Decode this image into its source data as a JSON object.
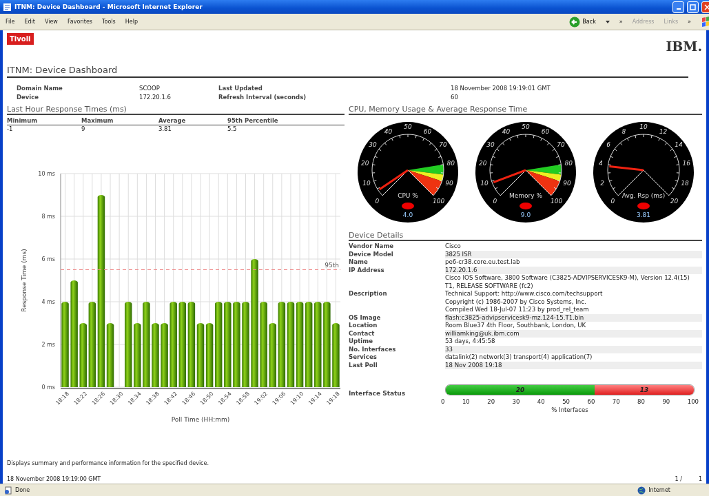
{
  "window": {
    "title": "ITNM: Device Dashboard - Microsoft Internet Explorer"
  },
  "menu": [
    "File",
    "Edit",
    "View",
    "Favorites",
    "Tools",
    "Help"
  ],
  "toolbar": {
    "back": "Back",
    "chevron": "»",
    "address": "Address",
    "links": "Links",
    "links_chevron": "»"
  },
  "header": {
    "badge": "Tivoli",
    "logo": "IBM.",
    "title": "ITNM: Device Dashboard"
  },
  "summary": [
    {
      "label": "Domain Name",
      "value": "SCOOP",
      "label2": "Last Updated",
      "value2": "18 November 2008 19:19:01 GMT"
    },
    {
      "label": "Device",
      "value": "172.20.1.6",
      "label2": "Refresh Interval (seconds)",
      "value2": "60"
    }
  ],
  "response": {
    "title": "Last Hour Response Times (ms)",
    "columns": [
      "Minimum",
      "Maximum",
      "Average",
      "95th Percentile"
    ],
    "values": [
      "-1",
      "9",
      "3.81",
      "5.5"
    ],
    "chart_data": {
      "type": "bar",
      "xlabel": "Poll Time  (HH:mm)",
      "ylabel": "Response Time (ms)",
      "categories": [
        "18:18",
        null,
        "18:22",
        null,
        "18:26",
        null,
        "18:30",
        null,
        "18:34",
        null,
        "18:38",
        null,
        "18:42",
        null,
        "18:46",
        null,
        "18:50",
        null,
        "18:54",
        null,
        "18:58",
        null,
        "19:02",
        null,
        "19:06",
        null,
        "19:10",
        null,
        "19:14",
        null,
        "19:18"
      ],
      "grid": true,
      "values": [
        4,
        5,
        3,
        4,
        9,
        3,
        0,
        4,
        3,
        4,
        3,
        3,
        4,
        4,
        4,
        3,
        3,
        4,
        4,
        4,
        4,
        6,
        4,
        3,
        4,
        4,
        4,
        4,
        4,
        4,
        3
      ],
      "ylim": [
        0,
        10
      ],
      "yticks": [
        {
          "value": 0,
          "label": "0 ms"
        },
        {
          "value": 2,
          "label": "2 ms"
        },
        {
          "value": 4,
          "label": "4 ms"
        },
        {
          "value": 6,
          "label": "6 ms"
        },
        {
          "value": 8,
          "label": "8 ms"
        },
        {
          "value": 10,
          "label": "10 ms"
        }
      ],
      "ref_lines": [
        {
          "axis": "y",
          "value": 5.5,
          "label": "95th"
        }
      ]
    }
  },
  "gauges_title": "CPU, Memory Usage & Average Response Time",
  "gauges": [
    {
      "kind": "percent",
      "label": "CPU %",
      "reading": "4.0",
      "scale": [
        "0",
        "10",
        "20",
        "30",
        "40",
        "50",
        "60",
        "70",
        "80",
        "90",
        "100"
      ]
    },
    {
      "kind": "percent",
      "label": "Memory %",
      "reading": "9.0",
      "scale": [
        "0",
        "10",
        "20",
        "30",
        "40",
        "50",
        "60",
        "70",
        "80",
        "90",
        "100"
      ]
    },
    {
      "kind": "time",
      "label": "Avg. Rsp (ms)",
      "reading": "3.81",
      "scale": [
        "0",
        "2",
        "4",
        "6",
        "8",
        "10",
        "12",
        "14",
        "16",
        "18",
        "20"
      ]
    }
  ],
  "details": {
    "title": "Device Details",
    "rows": [
      {
        "label": "Vendor Name",
        "lines": [
          "Cisco"
        ]
      },
      {
        "label": "Device Model",
        "lines": [
          "3825 ISR"
        ]
      },
      {
        "label": "Name",
        "lines": [
          "pe6-cr38.core.eu.test.lab"
        ]
      },
      {
        "label": "IP Address",
        "lines": [
          "172.20.1.6"
        ]
      },
      {
        "label": "Description",
        "lines": [
          "Cisco IOS Software, 3800 Software (C3825-ADVIPSERVICESK9-M), Version 12.4(15)",
          "T1, RELEASE SOFTWARE (fc2)",
          "Technical Support: http://www.cisco.com/techsupport",
          "Copyright (c) 1986-2007 by Cisco Systems, Inc.",
          "Compiled Wed 18-Jul-07 11:23 by prod_rel_team"
        ]
      },
      {
        "label": "OS Image",
        "lines": [
          "flash:c3825-advipservicesk9-mz.124-15.T1.bin"
        ]
      },
      {
        "label": "Location",
        "lines": [
          "Room Blue37 4th Floor, Southbank, London, UK"
        ]
      },
      {
        "label": "Contact",
        "lines": [
          "williamking@uk.ibm.com"
        ]
      },
      {
        "label": "Uptime",
        "lines": [
          "53 days, 4:45:58"
        ]
      },
      {
        "label": "No. Interfaces",
        "lines": [
          "33"
        ]
      },
      {
        "label": "Services",
        "lines": [
          "datalink(2) network(3) transport(4) application(7)"
        ]
      },
      {
        "label": "Last Poll",
        "lines": [
          "18 Nov 2008 19:18"
        ]
      }
    ],
    "interface_status": {
      "label": "Interface Status",
      "up": "20",
      "down": "13",
      "level": 0.6,
      "ticks": [
        "0",
        "10",
        "20",
        "30",
        "40",
        "50",
        "60",
        "70",
        "80",
        "90",
        "100"
      ],
      "axis_label": "% Interfaces"
    }
  },
  "footer": {
    "description": "Displays summary and performance information for the specified device.",
    "timestamp": "18 November 2008 19:19:00 GMT",
    "page": "1 /",
    "pages": "1"
  },
  "status_bar": {
    "text": "Done",
    "zone": "Internet"
  }
}
